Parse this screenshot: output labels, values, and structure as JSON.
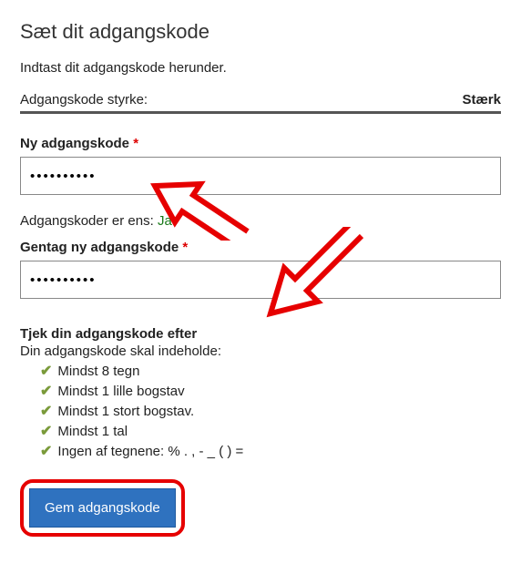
{
  "title": "Sæt dit adgangskode",
  "intro": "Indtast dit adgangskode herunder.",
  "strength": {
    "label": "Adgangskode styrke:",
    "value": "Stærk"
  },
  "fields": {
    "new_password": {
      "label": "Ny adgangskode",
      "value": "••••••••••"
    },
    "confirm_password": {
      "label": "Gentag ny adgangskode",
      "value": "••••••••••"
    },
    "required_mark": "*"
  },
  "match": {
    "label": "Adgangskoder er ens:",
    "value": "Ja"
  },
  "checks": {
    "heading": "Tjek din adgangskode efter",
    "subheading": "Din adgangskode skal indeholde:",
    "rules": [
      "Mindst 8 tegn",
      "Mindst 1 lille bogstav",
      "Mindst 1 stort bogstav.",
      "Mindst 1 tal",
      "Ingen af tegnene: % . , - _ ( ) ="
    ]
  },
  "submit_label": "Gem adgangskode"
}
